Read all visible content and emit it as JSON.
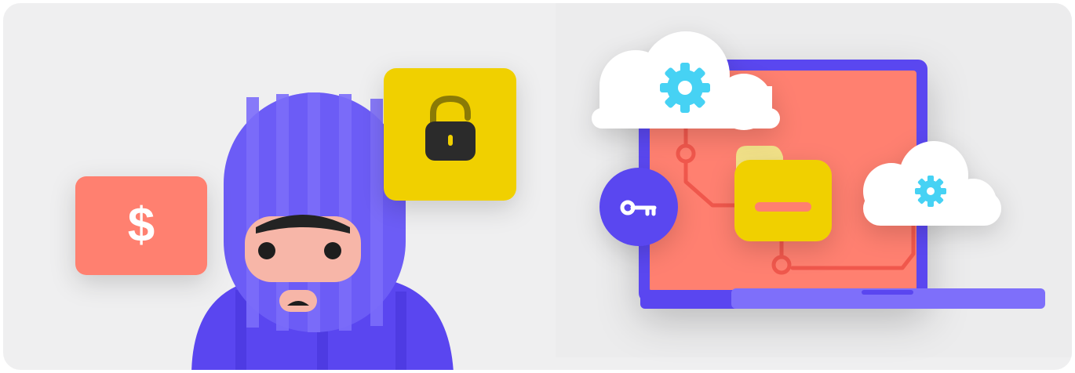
{
  "illustration": {
    "dollar_symbol": "$",
    "icons": [
      "thief-icon",
      "dollar-card-icon",
      "unlocked-padlock-icon",
      "laptop-icon",
      "cloud-gear-icon",
      "key-icon",
      "folder-icon"
    ],
    "colors": {
      "background": "#efeff0",
      "accent_purple": "#5a46f0",
      "light_purple": "#6c5cf6",
      "salmon": "#ff8070",
      "yellow": "#f0d000",
      "gear_cyan": "#46d2f4"
    }
  }
}
